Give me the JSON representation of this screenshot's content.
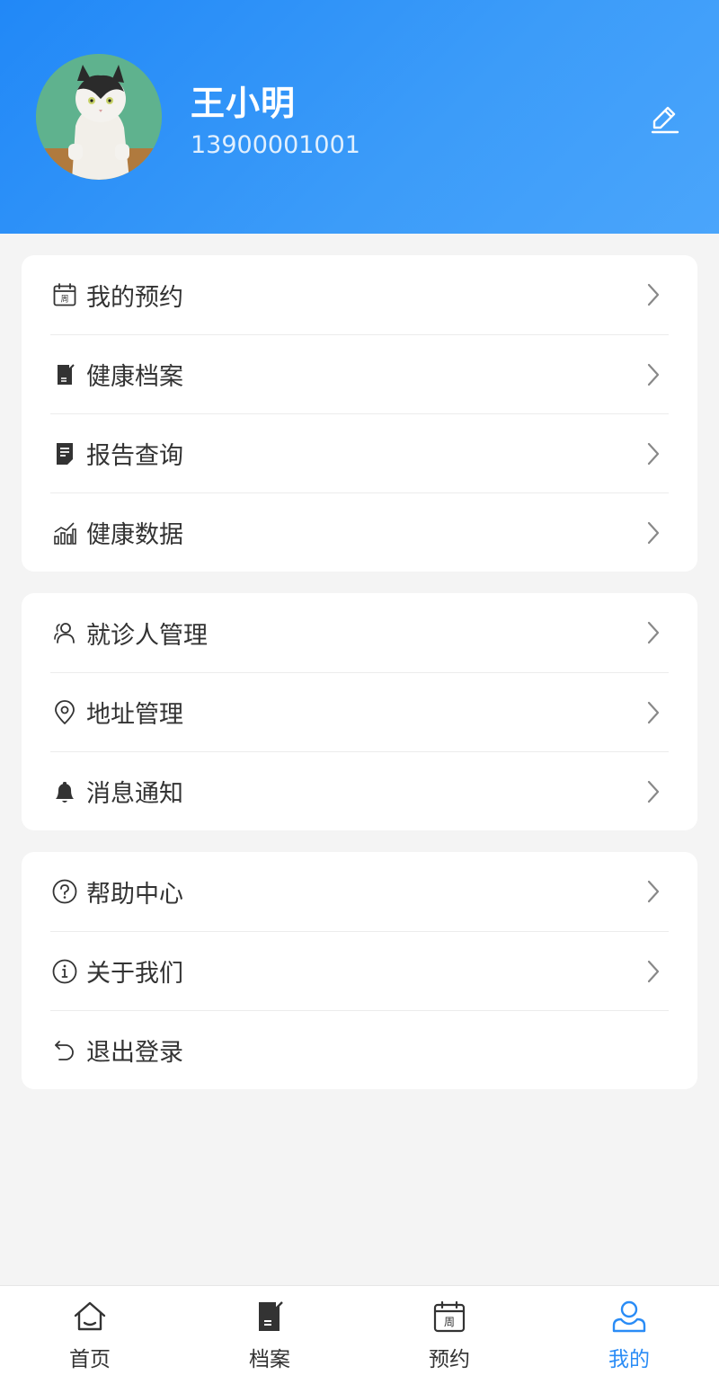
{
  "profile": {
    "name": "王小明",
    "phone": "13900001001"
  },
  "menu_groups": [
    {
      "items": [
        {
          "label": "我的预约",
          "icon": "calendar-icon"
        },
        {
          "label": "健康档案",
          "icon": "record-icon"
        },
        {
          "label": "报告查询",
          "icon": "report-icon"
        },
        {
          "label": "健康数据",
          "icon": "chart-icon"
        }
      ]
    },
    {
      "items": [
        {
          "label": "就诊人管理",
          "icon": "users-icon"
        },
        {
          "label": "地址管理",
          "icon": "location-icon"
        },
        {
          "label": "消息通知",
          "icon": "bell-icon"
        }
      ]
    },
    {
      "items": [
        {
          "label": "帮助中心",
          "icon": "help-icon"
        },
        {
          "label": "关于我们",
          "icon": "info-icon"
        },
        {
          "label": "退出登录",
          "icon": "logout-icon"
        }
      ]
    }
  ],
  "calendar_icon_glyph": "周",
  "tabbar": {
    "active": "我的",
    "tabs": [
      {
        "label": "首页",
        "icon": "home-icon"
      },
      {
        "label": "档案",
        "icon": "record-icon"
      },
      {
        "label": "预约",
        "icon": "calendar-icon"
      },
      {
        "label": "我的",
        "icon": "user-icon"
      }
    ]
  },
  "colors": {
    "header_start": "#2188f7",
    "header_end": "#4aa5fb",
    "active_tab": "#2a8cf6",
    "background": "#f4f4f4"
  }
}
